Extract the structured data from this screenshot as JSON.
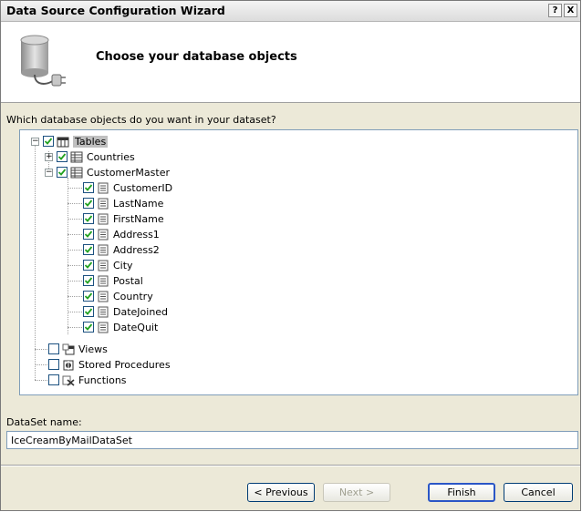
{
  "window": {
    "title": "Data Source Configuration Wizard",
    "help_glyph": "?",
    "close_glyph": "X"
  },
  "header": {
    "title": "Choose your database objects"
  },
  "question": "Which database objects do you want in your dataset?",
  "tree": {
    "tables_label": "Tables",
    "countries_label": "Countries",
    "customermaster_label": "CustomerMaster",
    "columns": [
      "CustomerID",
      "LastName",
      "FirstName",
      "Address1",
      "Address2",
      "City",
      "Postal",
      "Country",
      "DateJoined",
      "DateQuit"
    ],
    "views_label": "Views",
    "stored_procedures_label": "Stored Procedures",
    "functions_label": "Functions"
  },
  "dataset": {
    "label": "DataSet name:",
    "value": "IceCreamByMailDataSet"
  },
  "buttons": {
    "previous": "< Previous",
    "next": "Next >",
    "finish": "Finish",
    "cancel": "Cancel"
  },
  "colors": {
    "dialog_bg": "#ece9d8",
    "tree_border": "#7f9db9",
    "checkbox_border": "#1c5180",
    "check_mark": "#21a121"
  }
}
